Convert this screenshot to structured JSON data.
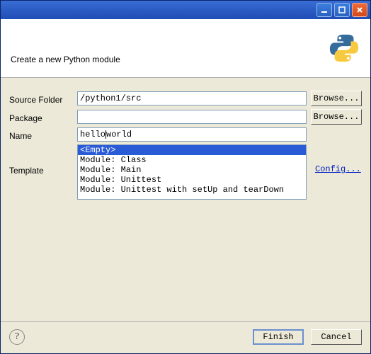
{
  "banner": {
    "text": "Create a new Python module"
  },
  "labels": {
    "source_folder": "Source Folder",
    "package": "Package",
    "name": "Name",
    "template": "Template"
  },
  "fields": {
    "source_folder": "/python1/src",
    "package": "",
    "name_pre": "hello",
    "name_post": "world"
  },
  "buttons": {
    "browse": "Browse...",
    "config": "Config...",
    "finish": "Finish",
    "cancel": "Cancel",
    "help": "?"
  },
  "templates": [
    {
      "label": "<Empty>",
      "selected": true
    },
    {
      "label": "Module: Class",
      "selected": false
    },
    {
      "label": "Module: Main",
      "selected": false
    },
    {
      "label": "Module: Unittest",
      "selected": false
    },
    {
      "label": "Module: Unittest with setUp and tearDown",
      "selected": false
    }
  ]
}
